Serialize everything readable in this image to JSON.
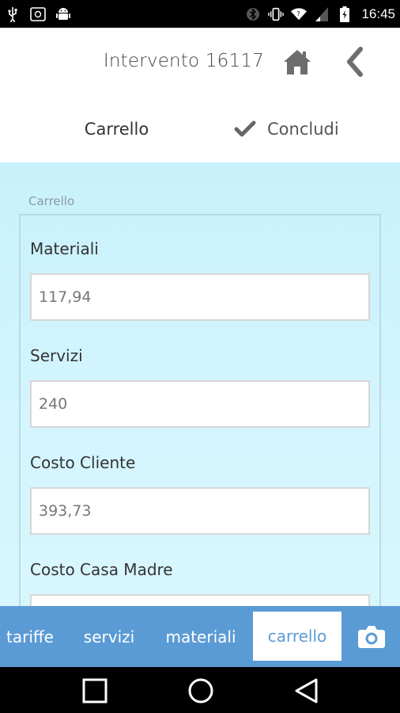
{
  "status_bar": {
    "time": "16:45",
    "icons": [
      "usb-icon",
      "notification-icon",
      "android-icon",
      "bluetooth-icon",
      "vibrate-icon",
      "wifi-icon",
      "signal-icon",
      "battery-icon"
    ]
  },
  "header": {
    "title": "Intervento 16117",
    "home_icon": "home-icon",
    "back_icon": "chevron-left-icon"
  },
  "tabs": {
    "carrello": "Carrello",
    "concludi": "Concludi"
  },
  "form": {
    "legend": "Carrello",
    "fields": [
      {
        "label": "Materiali",
        "value": "117,94"
      },
      {
        "label": "Servizi",
        "value": "240"
      },
      {
        "label": "Costo Cliente",
        "value": "393,73"
      },
      {
        "label": "Costo Casa Madre",
        "value": ""
      }
    ]
  },
  "bottom_tabs": {
    "tariffe": "tariffe",
    "servizi": "servizi",
    "materiali": "materiali",
    "carrello": "carrello",
    "camera_icon": "camera-icon"
  },
  "colors": {
    "accent": "#5b9bd5",
    "content_bg": "#c8f1fc"
  }
}
